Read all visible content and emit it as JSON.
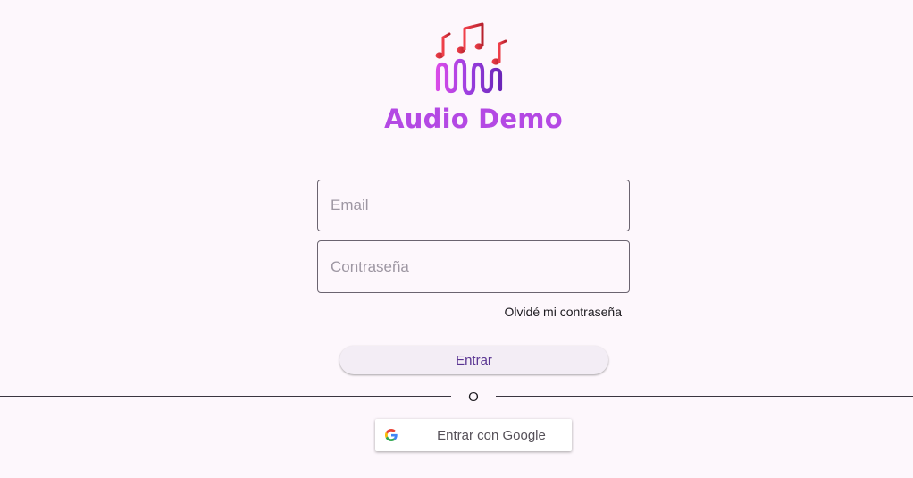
{
  "app": {
    "title": "Audio Demo"
  },
  "form": {
    "email_placeholder": "Email",
    "email_value": "",
    "password_placeholder": "Contraseña",
    "password_value": "",
    "forgot_password_label": "Olvidé mi contraseña",
    "login_label": "Entrar"
  },
  "divider": {
    "text": "O"
  },
  "google": {
    "label": "Entrar con Google",
    "icon": "google-icon"
  },
  "colors": {
    "background": "#fdf7fc",
    "title": "#b449e4",
    "login_text": "#5a3592",
    "logo_notes": "#e0323f",
    "logo_wave": "#a44ad8"
  }
}
